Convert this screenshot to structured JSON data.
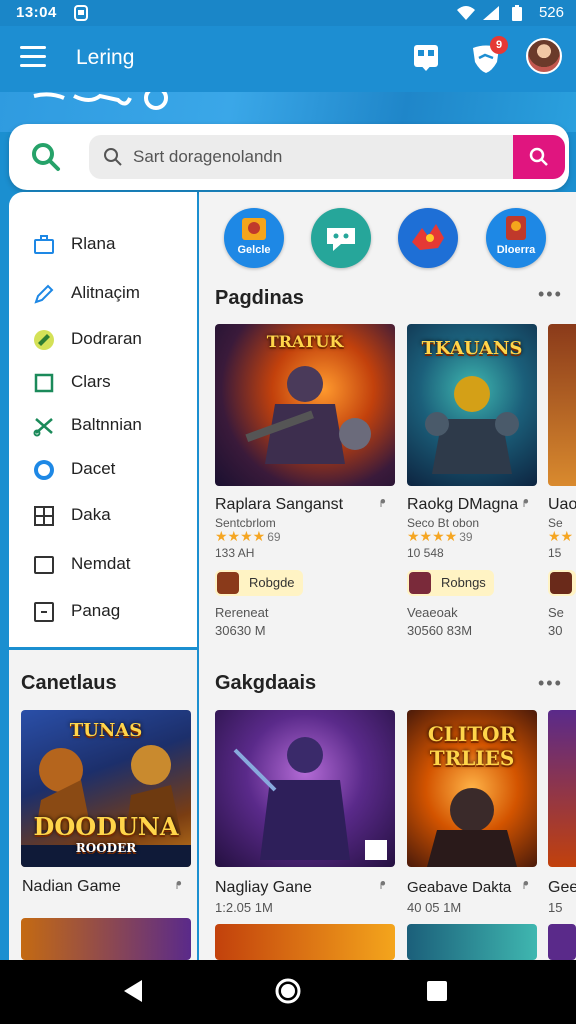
{
  "status": {
    "time": "13:04",
    "battery": "526"
  },
  "appbar": {
    "title": "Lering",
    "notification_count": "9"
  },
  "search": {
    "placeholder": "Sart doragenolandn"
  },
  "drawer": {
    "items": [
      {
        "label": "Rlana",
        "icon": "briefcase-icon"
      },
      {
        "label": "Alitnaçim",
        "icon": "pencil-icon"
      },
      {
        "label": "Dodraran",
        "icon": "check-badge-icon"
      },
      {
        "label": "Clars",
        "icon": "square-icon"
      },
      {
        "label": "Baltnnian",
        "icon": "scissors-icon"
      },
      {
        "label": "Dacet",
        "icon": "circle-target-icon"
      },
      {
        "label": "Daka",
        "icon": "grid-icon"
      },
      {
        "label": "Nemdat",
        "icon": "frame-icon"
      },
      {
        "label": "Panag",
        "icon": "square-dot-icon"
      }
    ]
  },
  "categories": [
    {
      "label": "Gelcle",
      "color": "#1e88e5"
    },
    {
      "label": "",
      "color": "#26a69a"
    },
    {
      "label": "",
      "color": "#1e6fd6"
    },
    {
      "label": "Dloerra",
      "color": "#1e88e5"
    }
  ],
  "section1": {
    "title": "Pagdinas",
    "cards": [
      {
        "name": "Raplara Sanganst",
        "publisher": "Sentcbrlom",
        "rating_count": "69",
        "size": "133 AH",
        "pill_label": "Robgde",
        "sub": "Rereneat",
        "price": "30630 M",
        "art_title": "TRATUK"
      },
      {
        "name": "Raokg DMagna",
        "publisher": "Seco Bt obon",
        "rating_count": "39",
        "size": "10 548",
        "pill_label": "Robngs",
        "sub": "Veaeoak",
        "price": "30560 83M",
        "art_title": "TKAUANS"
      },
      {
        "name": "Uao",
        "publisher": "Se",
        "rating_count": "",
        "size": "15",
        "pill_label": "",
        "sub": "Se",
        "price": "30",
        "art_title": ""
      }
    ]
  },
  "left_section": {
    "title": "Canetlaus",
    "card": {
      "name": "Nadian Game",
      "art_title_top": "TUNAS",
      "art_title": "DOODUNA",
      "art_subtitle": "ROODER"
    }
  },
  "section2": {
    "title": "Gakgdaais",
    "cards": [
      {
        "name": "Nagliay Gane",
        "size": "1:2.05 1M"
      },
      {
        "name": "Geabave Dakta",
        "size": "40 05 1M",
        "art_title": "CLITOR TRLIES"
      },
      {
        "name": "Gee",
        "size": "15"
      }
    ]
  },
  "colors": {
    "primary": "#1d8ed2",
    "accent": "#e0157f",
    "star": "#f5a623",
    "pill": "#fff3c4"
  }
}
